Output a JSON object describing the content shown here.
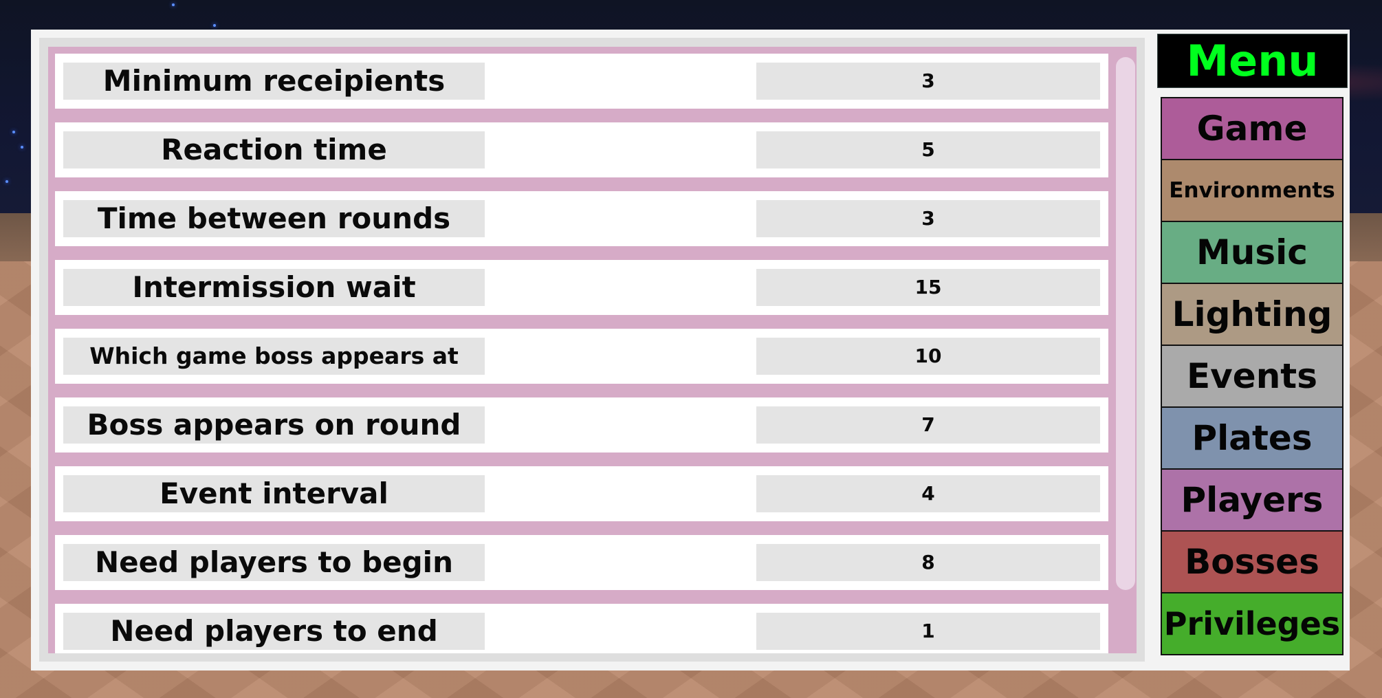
{
  "settings": {
    "rows": [
      {
        "label": "Minimum receipients",
        "value": "3"
      },
      {
        "label": "Reaction time",
        "value": "5"
      },
      {
        "label": "Time between rounds",
        "value": "3"
      },
      {
        "label": "Intermission wait",
        "value": "15"
      },
      {
        "label": "Which game boss appears at",
        "value": "10"
      },
      {
        "label": "Boss appears on round",
        "value": "7"
      },
      {
        "label": "Event interval",
        "value": "4"
      },
      {
        "label": "Need players to begin",
        "value": "8"
      },
      {
        "label": "Need players to end",
        "value": "1"
      }
    ]
  },
  "menu": {
    "title": "Menu",
    "title_color": "#00ff1e",
    "items": [
      {
        "label": "Game",
        "color": "#ad5c99"
      },
      {
        "label": "Environments",
        "color": "#ad8a6d"
      },
      {
        "label": "Music",
        "color": "#68ad84"
      },
      {
        "label": "Lighting",
        "color": "#ad9a84"
      },
      {
        "label": "Events",
        "color": "#aaaaaa"
      },
      {
        "label": "Plates",
        "color": "#7f92ad"
      },
      {
        "label": "Players",
        "color": "#ad72a8"
      },
      {
        "label": "Bosses",
        "color": "#ad5353"
      },
      {
        "label": "Privileges",
        "color": "#45ad2b"
      }
    ]
  },
  "theme": {
    "frame_color": "#d6abc7",
    "scrollbar_color": "#ead5e5"
  }
}
